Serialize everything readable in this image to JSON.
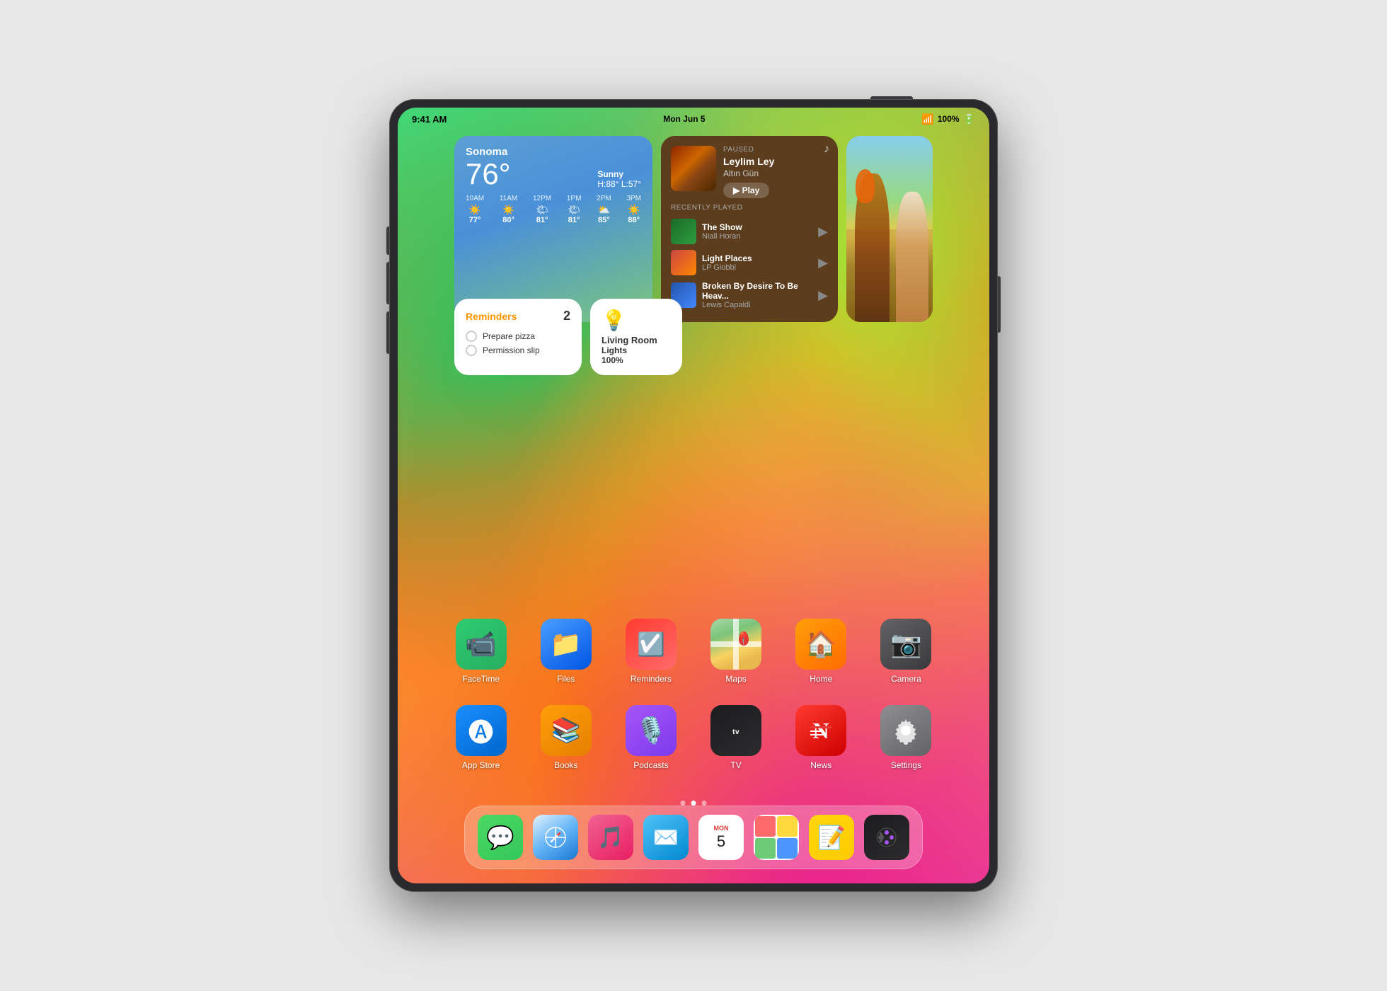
{
  "device": {
    "type": "iPad"
  },
  "status_bar": {
    "time": "9:41 AM",
    "date": "Mon Jun 5",
    "wifi": "WiFi",
    "battery_level": "100%"
  },
  "weather_widget": {
    "city": "Sonoma",
    "temperature": "76°",
    "condition": "Sunny",
    "high": "H:88°",
    "low": "L:57°",
    "forecast": [
      {
        "time": "10AM",
        "icon": "☀️",
        "temp": "77°"
      },
      {
        "time": "11AM",
        "icon": "☀️",
        "temp": "80°"
      },
      {
        "time": "12PM",
        "icon": "🌤",
        "temp": "81°"
      },
      {
        "time": "1PM",
        "icon": "🌤",
        "temp": "81°"
      },
      {
        "time": "2PM",
        "icon": "⛅",
        "temp": "85°"
      },
      {
        "time": "3PM",
        "icon": "☀️",
        "temp": "88°"
      }
    ]
  },
  "music_widget": {
    "status": "PAUSED",
    "title": "Leylim Ley",
    "artist": "Altın Gün",
    "play_label": "▶ Play",
    "recently_played_label": "RECENTLY PLAYED",
    "recent_tracks": [
      {
        "title": "The Show",
        "artist": "Niall Horan"
      },
      {
        "title": "Light Places",
        "artist": "LP Giobbi"
      },
      {
        "title": "Broken By Desire To Be Heav...",
        "artist": "Lewis Capaldi"
      }
    ]
  },
  "reminders_widget": {
    "title": "Reminders",
    "count": "2",
    "items": [
      {
        "text": "Prepare pizza"
      },
      {
        "text": "Permission slip"
      }
    ]
  },
  "homekit_widget": {
    "label": "Living Room",
    "sublabel": "Lights",
    "value": "100%"
  },
  "app_grid_row1": {
    "apps": [
      {
        "id": "facetime",
        "label": "FaceTime"
      },
      {
        "id": "files",
        "label": "Files"
      },
      {
        "id": "reminders",
        "label": "Reminders"
      },
      {
        "id": "maps",
        "label": "Maps"
      },
      {
        "id": "home",
        "label": "Home"
      },
      {
        "id": "camera",
        "label": "Camera"
      }
    ]
  },
  "app_grid_row2": {
    "apps": [
      {
        "id": "appstore",
        "label": "App Store"
      },
      {
        "id": "books",
        "label": "Books"
      },
      {
        "id": "podcasts",
        "label": "Podcasts"
      },
      {
        "id": "tv",
        "label": "TV"
      },
      {
        "id": "news",
        "label": "News"
      },
      {
        "id": "settings",
        "label": "Settings"
      }
    ]
  },
  "dock": {
    "apps": [
      {
        "id": "messages",
        "label": "Messages"
      },
      {
        "id": "safari",
        "label": "Safari"
      },
      {
        "id": "music",
        "label": "Music"
      },
      {
        "id": "mail",
        "label": "Mail"
      },
      {
        "id": "calendar",
        "label": "Calendar",
        "day": "MON",
        "num": "5"
      },
      {
        "id": "photos",
        "label": "Photos"
      },
      {
        "id": "notes",
        "label": "Notes"
      },
      {
        "id": "arcade",
        "label": "Arcade"
      }
    ]
  },
  "page_dots": {
    "total": 3,
    "active": 1
  }
}
